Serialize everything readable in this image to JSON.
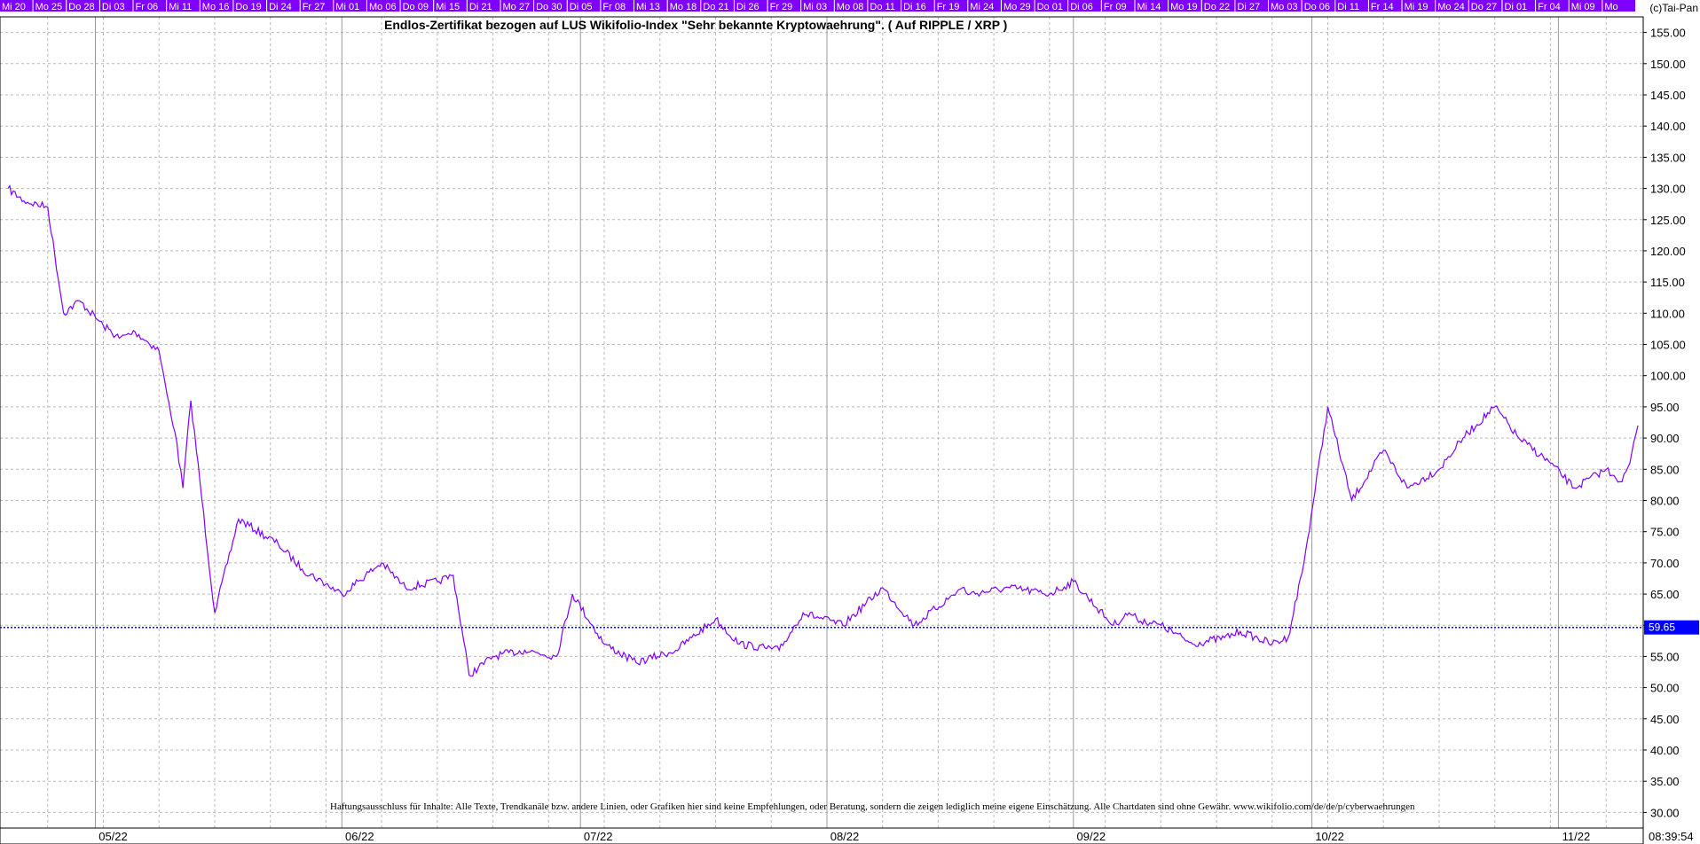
{
  "colors": {
    "series": "#8000ff",
    "tab_bg": "#8000ff",
    "current_line": "#0000ff",
    "grid": "#b8b8b8",
    "last_label_bg": "#0000ff"
  },
  "copyright": "(c)Tai-Pan",
  "clock": "08:39:54",
  "date_tabs": [
    "Mi 20",
    "Mo 25",
    "Do 28",
    "Di 03",
    "Fr 06",
    "Mi 11",
    "Mo 16",
    "Do 19",
    "Di 24",
    "Fr 27",
    "Mi 01",
    "Mo 06",
    "Do 09",
    "Mi 15",
    "Di 21",
    "Mo 27",
    "Do 30",
    "Di 05",
    "Fr 08",
    "Mi 13",
    "Mo 18",
    "Do 21",
    "Di 26",
    "Fr 29",
    "Mi 03",
    "Mo 08",
    "Do 11",
    "Di 16",
    "Fr 19",
    "Mi 24",
    "Mo 29",
    "Do 01",
    "Di 06",
    "Fr 09",
    "Mi 14",
    "Mo 19",
    "Do 22",
    "Di 27",
    "Mo 03",
    "Do 06",
    "Di 11",
    "Fr 14",
    "Mi 19",
    "Mo 24",
    "Do 27",
    "Di 01",
    "Fr 04",
    "Mi 09",
    "Mo"
  ],
  "disclaimer": "Haftungsausschluss für Inhalte: Alle Texte, Trendkanäle bzw. andere Linien, oder Grafiken hier sind keine Empfehlungen, oder Beratung, sondern die zeigen lediglich meine eigene Einschätzung. Alle Chartdaten sind ohne Gewähr.  www.wikifolio.com/de/de/p/cyberwaehrungen",
  "chart_data": {
    "type": "line",
    "title": "Endlos-Zertifikat bezogen auf LUS Wikifolio-Index \"Sehr bekannte Kryptowaehrung\". ( Auf RIPPLE / XRP )",
    "xlabel": "",
    "ylabel": "",
    "ylim": [
      27.5,
      157.5
    ],
    "yticks": [
      "30.00",
      "35.00",
      "40.00",
      "45.00",
      "50.00",
      "55.00",
      "60.00",
      "65.00",
      "70.00",
      "75.00",
      "80.00",
      "85.00",
      "90.00",
      "95.00",
      "100.00",
      "105.00",
      "110.00",
      "115.00",
      "120.00",
      "125.00",
      "130.00",
      "135.00",
      "140.00",
      "145.00",
      "150.00",
      "155.00"
    ],
    "x_month_labels": [
      "05/22",
      "06/22",
      "07/22",
      "08/22",
      "09/22",
      "10/22",
      "11/22"
    ],
    "last_value": "59.65",
    "grid": true,
    "series": [
      {
        "x": [
          "2022-04-20",
          "2022-04-22",
          "2022-04-25",
          "2022-04-27",
          "2022-04-29",
          "2022-05-02",
          "2022-05-04",
          "2022-05-06",
          "2022-05-09",
          "2022-05-10",
          "2022-05-11",
          "2022-05-12",
          "2022-05-13",
          "2022-05-16",
          "2022-05-19",
          "2022-05-24",
          "2022-05-27",
          "2022-06-01",
          "2022-06-06",
          "2022-06-09",
          "2022-06-13",
          "2022-06-15",
          "2022-06-17",
          "2022-06-20",
          "2022-06-24",
          "2022-06-28",
          "2022-06-30",
          "2022-07-04",
          "2022-07-08",
          "2022-07-13",
          "2022-07-15",
          "2022-07-18",
          "2022-07-21",
          "2022-07-26",
          "2022-07-29",
          "2022-08-03",
          "2022-08-08",
          "2022-08-12",
          "2022-08-18",
          "2022-08-19",
          "2022-08-24",
          "2022-08-29",
          "2022-09-01",
          "2022-09-06",
          "2022-09-08",
          "2022-09-09",
          "2022-09-12",
          "2022-09-16",
          "2022-09-20",
          "2022-09-22",
          "2022-09-26",
          "2022-09-28",
          "2022-09-30",
          "2022-10-03",
          "2022-10-06",
          "2022-10-10",
          "2022-10-13",
          "2022-10-17",
          "2022-10-20",
          "2022-10-24",
          "2022-10-27",
          "2022-10-31",
          "2022-11-03",
          "2022-11-07",
          "2022-11-08",
          "2022-11-09",
          "2022-11-10",
          "2022-11-11"
        ],
        "values": [
          130,
          128,
          127,
          110,
          112,
          108,
          106,
          107,
          104,
          97,
          91,
          82,
          96,
          62,
          77,
          73,
          69,
          65,
          70,
          66,
          67,
          68,
          52,
          55,
          56,
          55,
          65,
          57,
          54,
          56,
          58,
          61,
          57,
          56,
          62,
          60,
          66,
          60,
          66,
          65,
          66,
          65,
          67,
          60,
          62,
          61,
          60,
          57,
          58,
          59,
          57,
          58,
          70,
          95,
          80,
          88,
          82,
          85,
          90,
          95,
          90,
          86,
          82,
          85,
          84,
          83,
          86,
          92
        ]
      }
    ]
  }
}
